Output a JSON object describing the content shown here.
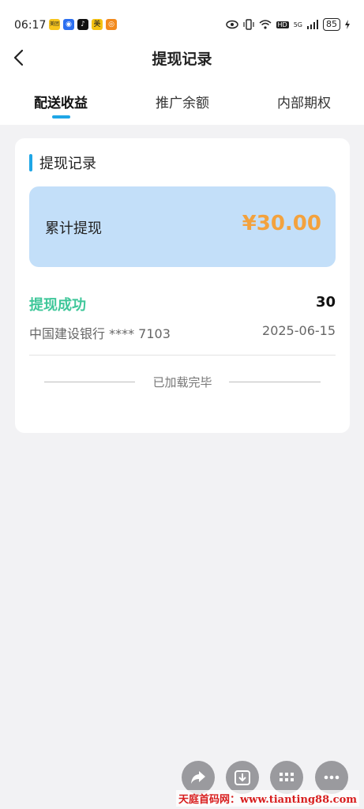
{
  "status_bar": {
    "time": "06:17",
    "app_icons": [
      {
        "name": "meituan-icon",
        "label": "美团",
        "color": "#f7c51d"
      },
      {
        "name": "camera-app-icon",
        "label": "◉",
        "color": "#2c6ff0"
      },
      {
        "name": "tiktok-icon",
        "label": "♪",
        "color": "#111111"
      },
      {
        "name": "meituan-mei-icon",
        "label": "美",
        "color": "#f5c212"
      },
      {
        "name": "orange-app-icon",
        "label": "◎",
        "color": "#f28a1e"
      }
    ],
    "network": "5G",
    "hd": "HD",
    "battery": "85"
  },
  "nav": {
    "title": "提现记录"
  },
  "tabs": [
    {
      "label": "配送收益",
      "active": true
    },
    {
      "label": "推广余额",
      "active": false
    },
    {
      "label": "内部期权",
      "active": false
    }
  ],
  "section": {
    "title": "提现记录"
  },
  "summary": {
    "label": "累计提现",
    "amount": "¥30.00"
  },
  "record": {
    "status": "提现成功",
    "amount": "30",
    "bank": "中国建设银行 **** 7103",
    "date": "2025-06-15"
  },
  "list_end_text": "已加载完毕",
  "colors": {
    "accent": "#1fa6e6",
    "success": "#3fc79a",
    "amount": "#f3a23e",
    "summary_bg": "#c3dff9"
  },
  "fabs": [
    "share-icon",
    "download-icon",
    "grid-icon",
    "more-icon"
  ],
  "watermark": "天庭首码网：www.tianting88.com"
}
